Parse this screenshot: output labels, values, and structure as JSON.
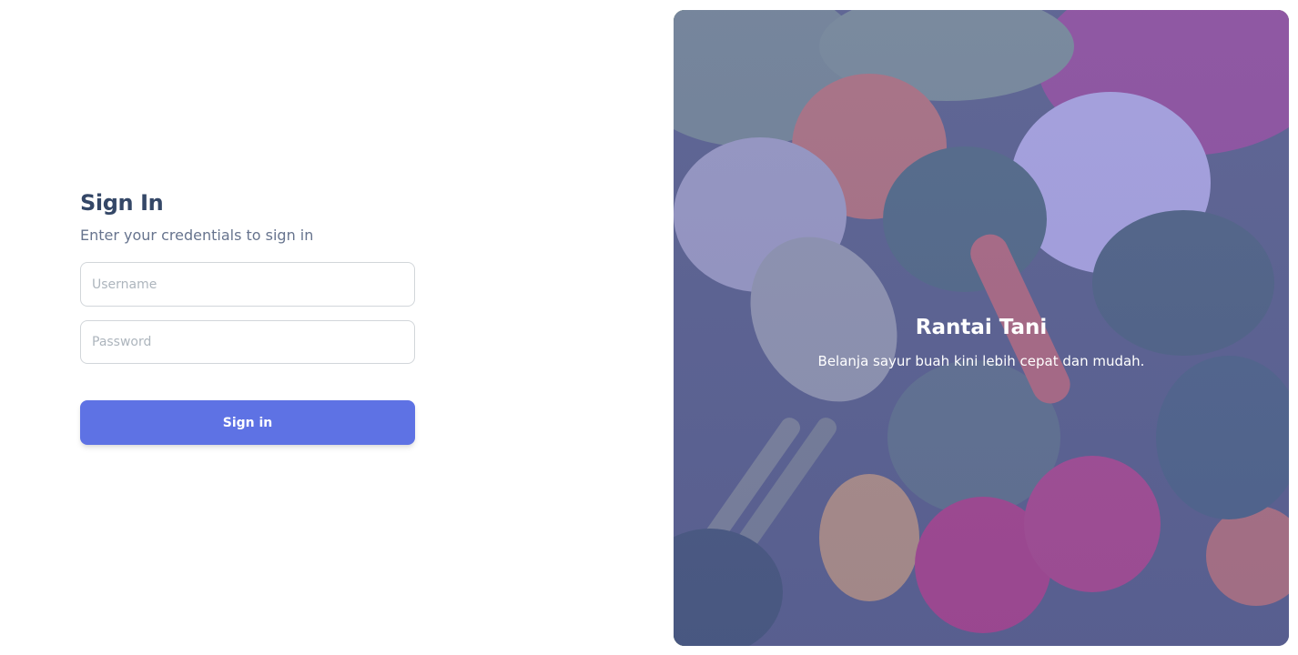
{
  "signin": {
    "title": "Sign In",
    "subtitle": "Enter your credentials to sign in",
    "username": {
      "placeholder": "Username",
      "value": ""
    },
    "password": {
      "placeholder": "Password",
      "value": ""
    },
    "submit_label": "Sign in"
  },
  "hero": {
    "title": "Rantai Tani",
    "tagline": "Belanja sayur buah kini lebih cepat dan mudah.",
    "image_icon": "vegetables-photo"
  },
  "colors": {
    "primary": "#5e72e4",
    "heading": "#344767",
    "text_muted": "#67748e",
    "hero_overlay": "#6c63b8"
  }
}
